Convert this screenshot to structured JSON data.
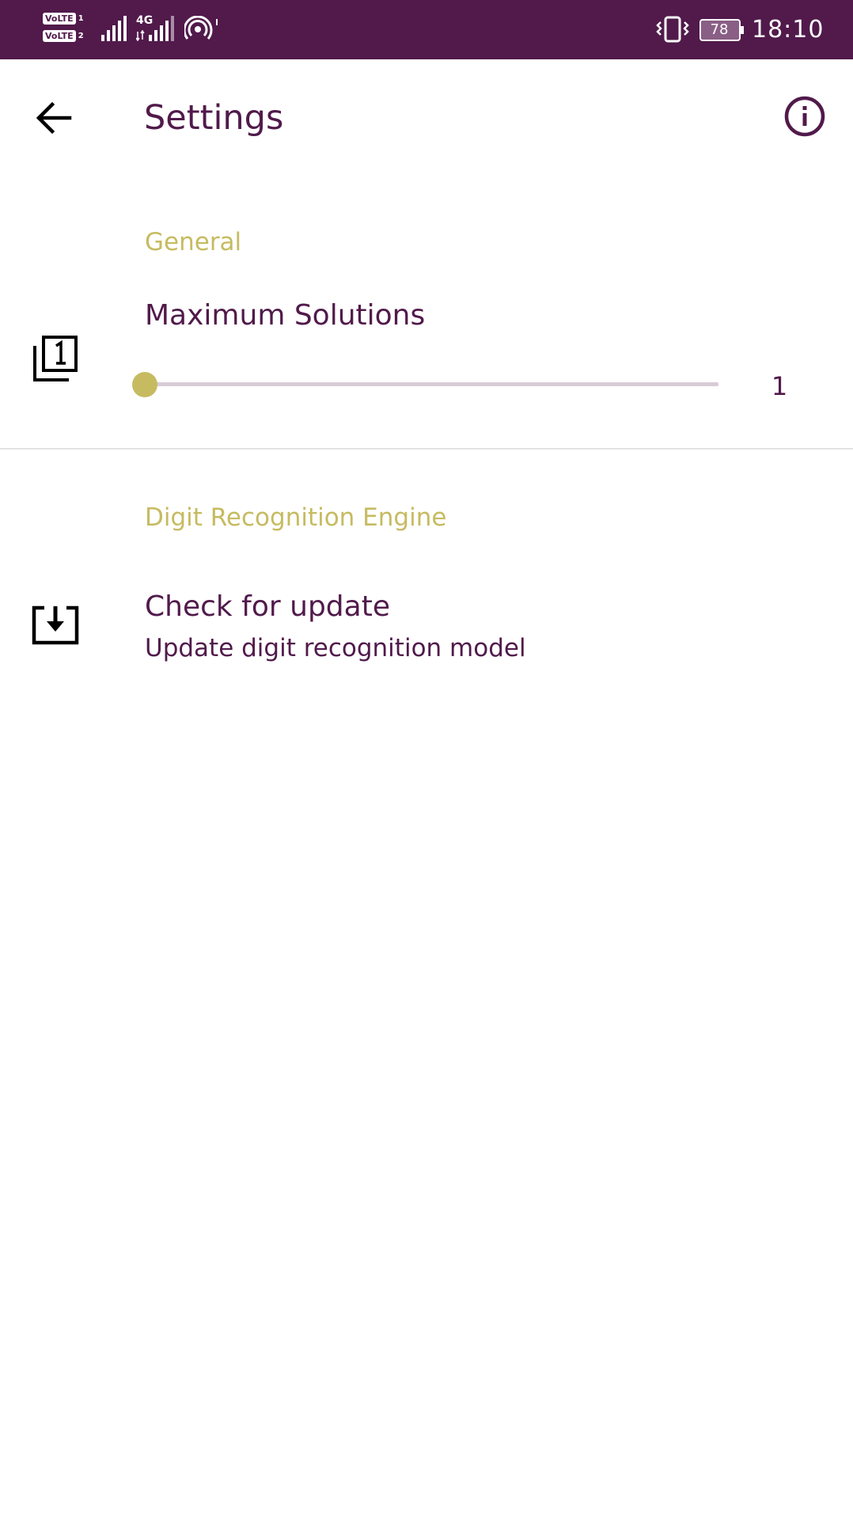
{
  "status_bar": {
    "volte_1": "VoLTE",
    "volte_1_sub": "1",
    "volte_2": "VoLTE",
    "volte_2_sub": "2",
    "network": "4G",
    "battery": "78",
    "time": "18:10",
    "background_color": "#511a4b"
  },
  "toolbar": {
    "title": "Settings",
    "back_icon": "arrow-back-icon",
    "info_icon": "info-icon"
  },
  "sections": {
    "general": {
      "header": "General",
      "max_solutions": {
        "title": "Maximum Solutions",
        "icon": "filter-1-icon",
        "slider_value": 0,
        "value_label": "1"
      }
    },
    "engine": {
      "header": "Digit Recognition Engine",
      "check_update": {
        "title": "Check for update",
        "summary": "Update digit recognition model",
        "icon": "system-update-icon"
      }
    }
  },
  "colors": {
    "primary": "#511a4b",
    "accent": "#c6bb61"
  }
}
